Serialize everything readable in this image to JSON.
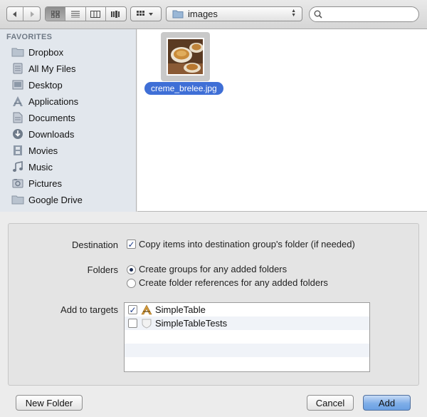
{
  "toolbar": {
    "path_label": "images",
    "search_placeholder": ""
  },
  "sidebar": {
    "heading": "FAVORITES",
    "items": [
      {
        "label": "Dropbox",
        "icon": "folder-icon"
      },
      {
        "label": "All My Files",
        "icon": "all-files-icon"
      },
      {
        "label": "Desktop",
        "icon": "desktop-icon"
      },
      {
        "label": "Applications",
        "icon": "applications-icon"
      },
      {
        "label": "Documents",
        "icon": "documents-icon"
      },
      {
        "label": "Downloads",
        "icon": "downloads-icon"
      },
      {
        "label": "Movies",
        "icon": "movies-icon"
      },
      {
        "label": "Music",
        "icon": "music-icon"
      },
      {
        "label": "Pictures",
        "icon": "pictures-icon"
      },
      {
        "label": "Google Drive",
        "icon": "folder-icon"
      }
    ]
  },
  "files": [
    {
      "name": "creme_brelee.jpg",
      "selected": true
    }
  ],
  "options": {
    "destination_label": "Destination",
    "destination_option": "Copy items into destination group's folder (if needed)",
    "destination_checked": true,
    "folders_label": "Folders",
    "folders_option_1": "Create groups for any added folders",
    "folders_option_2": "Create folder references for any added folders",
    "folders_selected": 1,
    "targets_label": "Add to targets",
    "targets": [
      {
        "name": "SimpleTable",
        "checked": true
      },
      {
        "name": "SimpleTableTests",
        "checked": false
      }
    ]
  },
  "buttons": {
    "new_folder": "New Folder",
    "cancel": "Cancel",
    "add": "Add"
  },
  "colors": {
    "selection": "#3f6fd6",
    "sidebar_bg": "#e2e7ed",
    "primary_button": "#6aa0e3"
  }
}
